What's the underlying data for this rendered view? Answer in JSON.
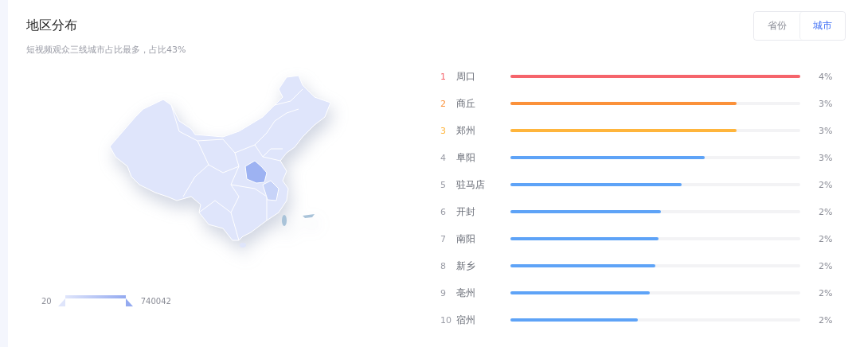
{
  "header": {
    "title": "地区分布",
    "subtitle": "短视频观众三线城市占比最多，占比43%"
  },
  "tabs": [
    {
      "label": "省份",
      "selected": false
    },
    {
      "label": "城市",
      "selected": true
    }
  ],
  "map": {
    "legend": {
      "min": "20",
      "max": "740042"
    }
  },
  "ranking": [
    {
      "rank": "1",
      "name": "周口",
      "level": 1.0,
      "value": "4%",
      "color": "#f5646b",
      "highlight": true
    },
    {
      "rank": "2",
      "name": "商丘",
      "level": 0.78,
      "value": "3%",
      "color": "#fb913a",
      "highlight": true
    },
    {
      "rank": "3",
      "name": "郑州",
      "level": 0.78,
      "value": "3%",
      "color": "#ffb53c",
      "highlight": true
    },
    {
      "rank": "4",
      "name": "阜阳",
      "level": 0.67,
      "value": "3%",
      "color": "#5ea3f7",
      "highlight": false
    },
    {
      "rank": "5",
      "name": "驻马店",
      "level": 0.59,
      "value": "2%",
      "color": "#5ea3f7",
      "highlight": false
    },
    {
      "rank": "6",
      "name": "开封",
      "level": 0.52,
      "value": "2%",
      "color": "#5ea3f7",
      "highlight": false
    },
    {
      "rank": "7",
      "name": "南阳",
      "level": 0.51,
      "value": "2%",
      "color": "#5ea3f7",
      "highlight": false
    },
    {
      "rank": "8",
      "name": "新乡",
      "level": 0.5,
      "value": "2%",
      "color": "#5ea3f7",
      "highlight": false
    },
    {
      "rank": "9",
      "name": "亳州",
      "level": 0.48,
      "value": "2%",
      "color": "#5ea3f7",
      "highlight": false
    },
    {
      "rank": "10",
      "name": "宿州",
      "level": 0.44,
      "value": "2%",
      "color": "#5ea3f7",
      "highlight": false
    }
  ]
}
